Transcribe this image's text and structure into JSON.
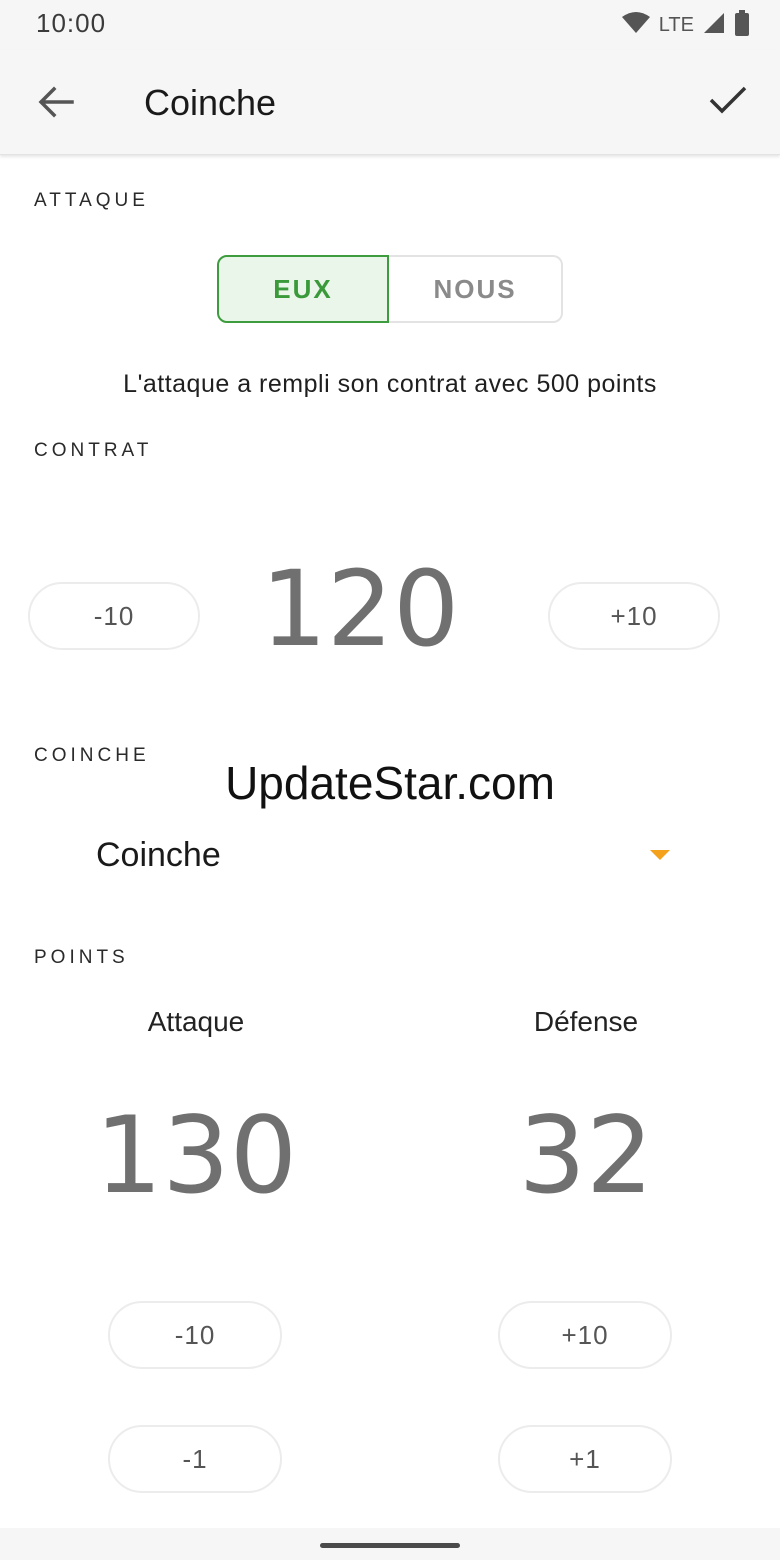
{
  "status_bar": {
    "time": "10:00",
    "network": "LTE"
  },
  "app_bar": {
    "title": "Coinche"
  },
  "attaque": {
    "label": "ATTAQUE",
    "options": [
      {
        "label": "EUX",
        "selected": true
      },
      {
        "label": "NOUS",
        "selected": false
      }
    ],
    "status_text": "L'attaque a rempli son contrat avec 500 points"
  },
  "contrat": {
    "label": "CONTRAT",
    "value": "120",
    "minus_label": "-10",
    "plus_label": "+10"
  },
  "coinche": {
    "label": "COINCHE",
    "selected": "Coinche"
  },
  "watermark": "UpdateStar.com",
  "points": {
    "label": "POINTS",
    "attaque": {
      "label": "Attaque",
      "value": "130"
    },
    "defense": {
      "label": "Défense",
      "value": "32"
    },
    "buttons": {
      "minus10": "-10",
      "plus10": "+10",
      "minus1": "-1",
      "plus1": "+1"
    }
  },
  "colors": {
    "accent_green": "#3a9a3a",
    "caret_orange": "#f4a11c"
  }
}
